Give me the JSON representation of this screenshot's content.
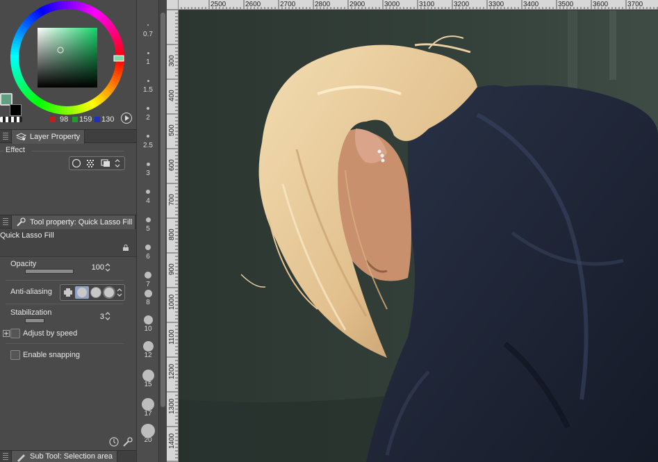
{
  "color_panel": {
    "red_value": "98",
    "green_value": "159",
    "blue_value": "130",
    "main_color": "#629f82",
    "sub_color": "#000000",
    "red_swatch": "#c21e1e",
    "green_swatch": "#1e9e2a",
    "blue_swatch": "#1e2fc2"
  },
  "layer_property": {
    "tab_label": "Layer Property",
    "effect_label": "Effect"
  },
  "tool_property": {
    "tab_label": "Tool property: Quick Lasso Fill",
    "tool_name": "Quick Lasso Fill",
    "opacity_label": "Opacity",
    "opacity_value": "100",
    "opacity_fraction": 1.0,
    "anti_aliasing_label": "Anti-aliasing",
    "stabilization_label": "Stabilization",
    "stabilization_value": "3",
    "adjust_by_speed_label": "Adjust by speed",
    "enable_snapping_label": "Enable snapping"
  },
  "sub_tool": {
    "tab_label": "Sub Tool: Selection area"
  },
  "brush_sizes": [
    "0.7",
    "1",
    "1.5",
    "2",
    "2.5",
    "3",
    "4",
    "5",
    "6",
    "7",
    "8",
    "10",
    "12",
    "15",
    "17",
    "20"
  ],
  "ruler_h": [
    "2500",
    "2600",
    "2700",
    "2800",
    "2900",
    "3000",
    "3100",
    "3200",
    "3300",
    "3400",
    "3500",
    "3600",
    "3700"
  ],
  "ruler_v": [
    "300",
    "400",
    "500",
    "600",
    "700",
    "800",
    "900",
    "1000",
    "1100",
    "1200",
    "1300",
    "1400"
  ],
  "canvas": {
    "background_color": "#2f3a35",
    "hair_color": "#e9cfa2",
    "skin_color": "#c98f6e",
    "coat_color": "#1f2638"
  }
}
